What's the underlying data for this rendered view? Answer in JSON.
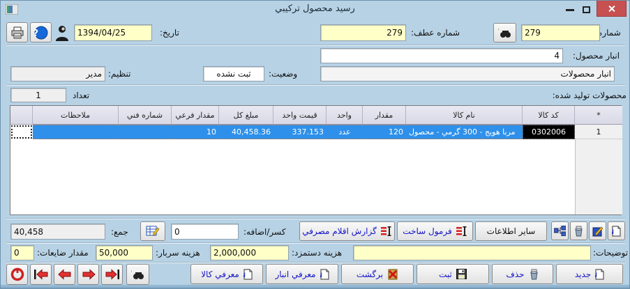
{
  "window": {
    "title": "رسيد محصول ترکيبي"
  },
  "header": {
    "number_label": "شماره:",
    "number_value": "279",
    "ref_label": "شماره عطف:",
    "ref_value": "279",
    "date_label": "تاريخ:",
    "date_value": "1394/04/25"
  },
  "warehouse": {
    "label": "انبار محصول:",
    "code": "4",
    "name": "انبار محصولات",
    "status_label": "وضعيت:",
    "status_value": "ثبت نشده",
    "regulator_label": "تنظيم:",
    "regulator_value": "مدير"
  },
  "products": {
    "title": "محصولات توليد شده:",
    "count_label": "تعداد",
    "count_value": "1"
  },
  "table": {
    "columns": {
      "row_marker": "*",
      "code": "کد کالا",
      "name": "نام کالا",
      "qty": "مقدار",
      "unit": "واحد",
      "unit_price": "قيمت واحد",
      "total": "مبلغ کل",
      "sub_qty": "مقدار فرعي",
      "tech_no": "شماره فني",
      "notes": "ملاحظات"
    },
    "rows": [
      {
        "row_no": "1",
        "code": "0302006",
        "name": "مربا هويج - 300 گرمي  - محصول",
        "qty": "120",
        "unit": "عدد",
        "unit_price": "337.153",
        "total": "40,458.36",
        "sub_qty": "10",
        "tech_no": "",
        "notes": ""
      }
    ]
  },
  "toolbar": {
    "other_info": "ساير اطلاعات",
    "formula": "فرمول ساخت",
    "consumption_report": "گزارش اقلام مصرفي",
    "adjust_label": "کسر/اضافه:",
    "adjust_value": "0",
    "sum_label": "جمع:",
    "sum_value": "40,458"
  },
  "costs": {
    "desc_label": "توضيحات:",
    "desc_value": "",
    "wage_label": "هزينه دستمزد:",
    "wage_value": "2,000,000",
    "overhead_label": "هزينه سربار:",
    "overhead_value": "50,000",
    "waste_label": "مقدار ضايعات:",
    "waste_value": "0"
  },
  "actions": {
    "new": "جديد",
    "delete": "حذف",
    "save": "ثبت",
    "back": "برگشت",
    "define_warehouse": "معرفي انبار",
    "define_product": "معرفي کالا"
  },
  "colors": {
    "accent_row": "#2e90ea",
    "input_yellow": "#ffffc8",
    "close_red": "#c75050"
  }
}
